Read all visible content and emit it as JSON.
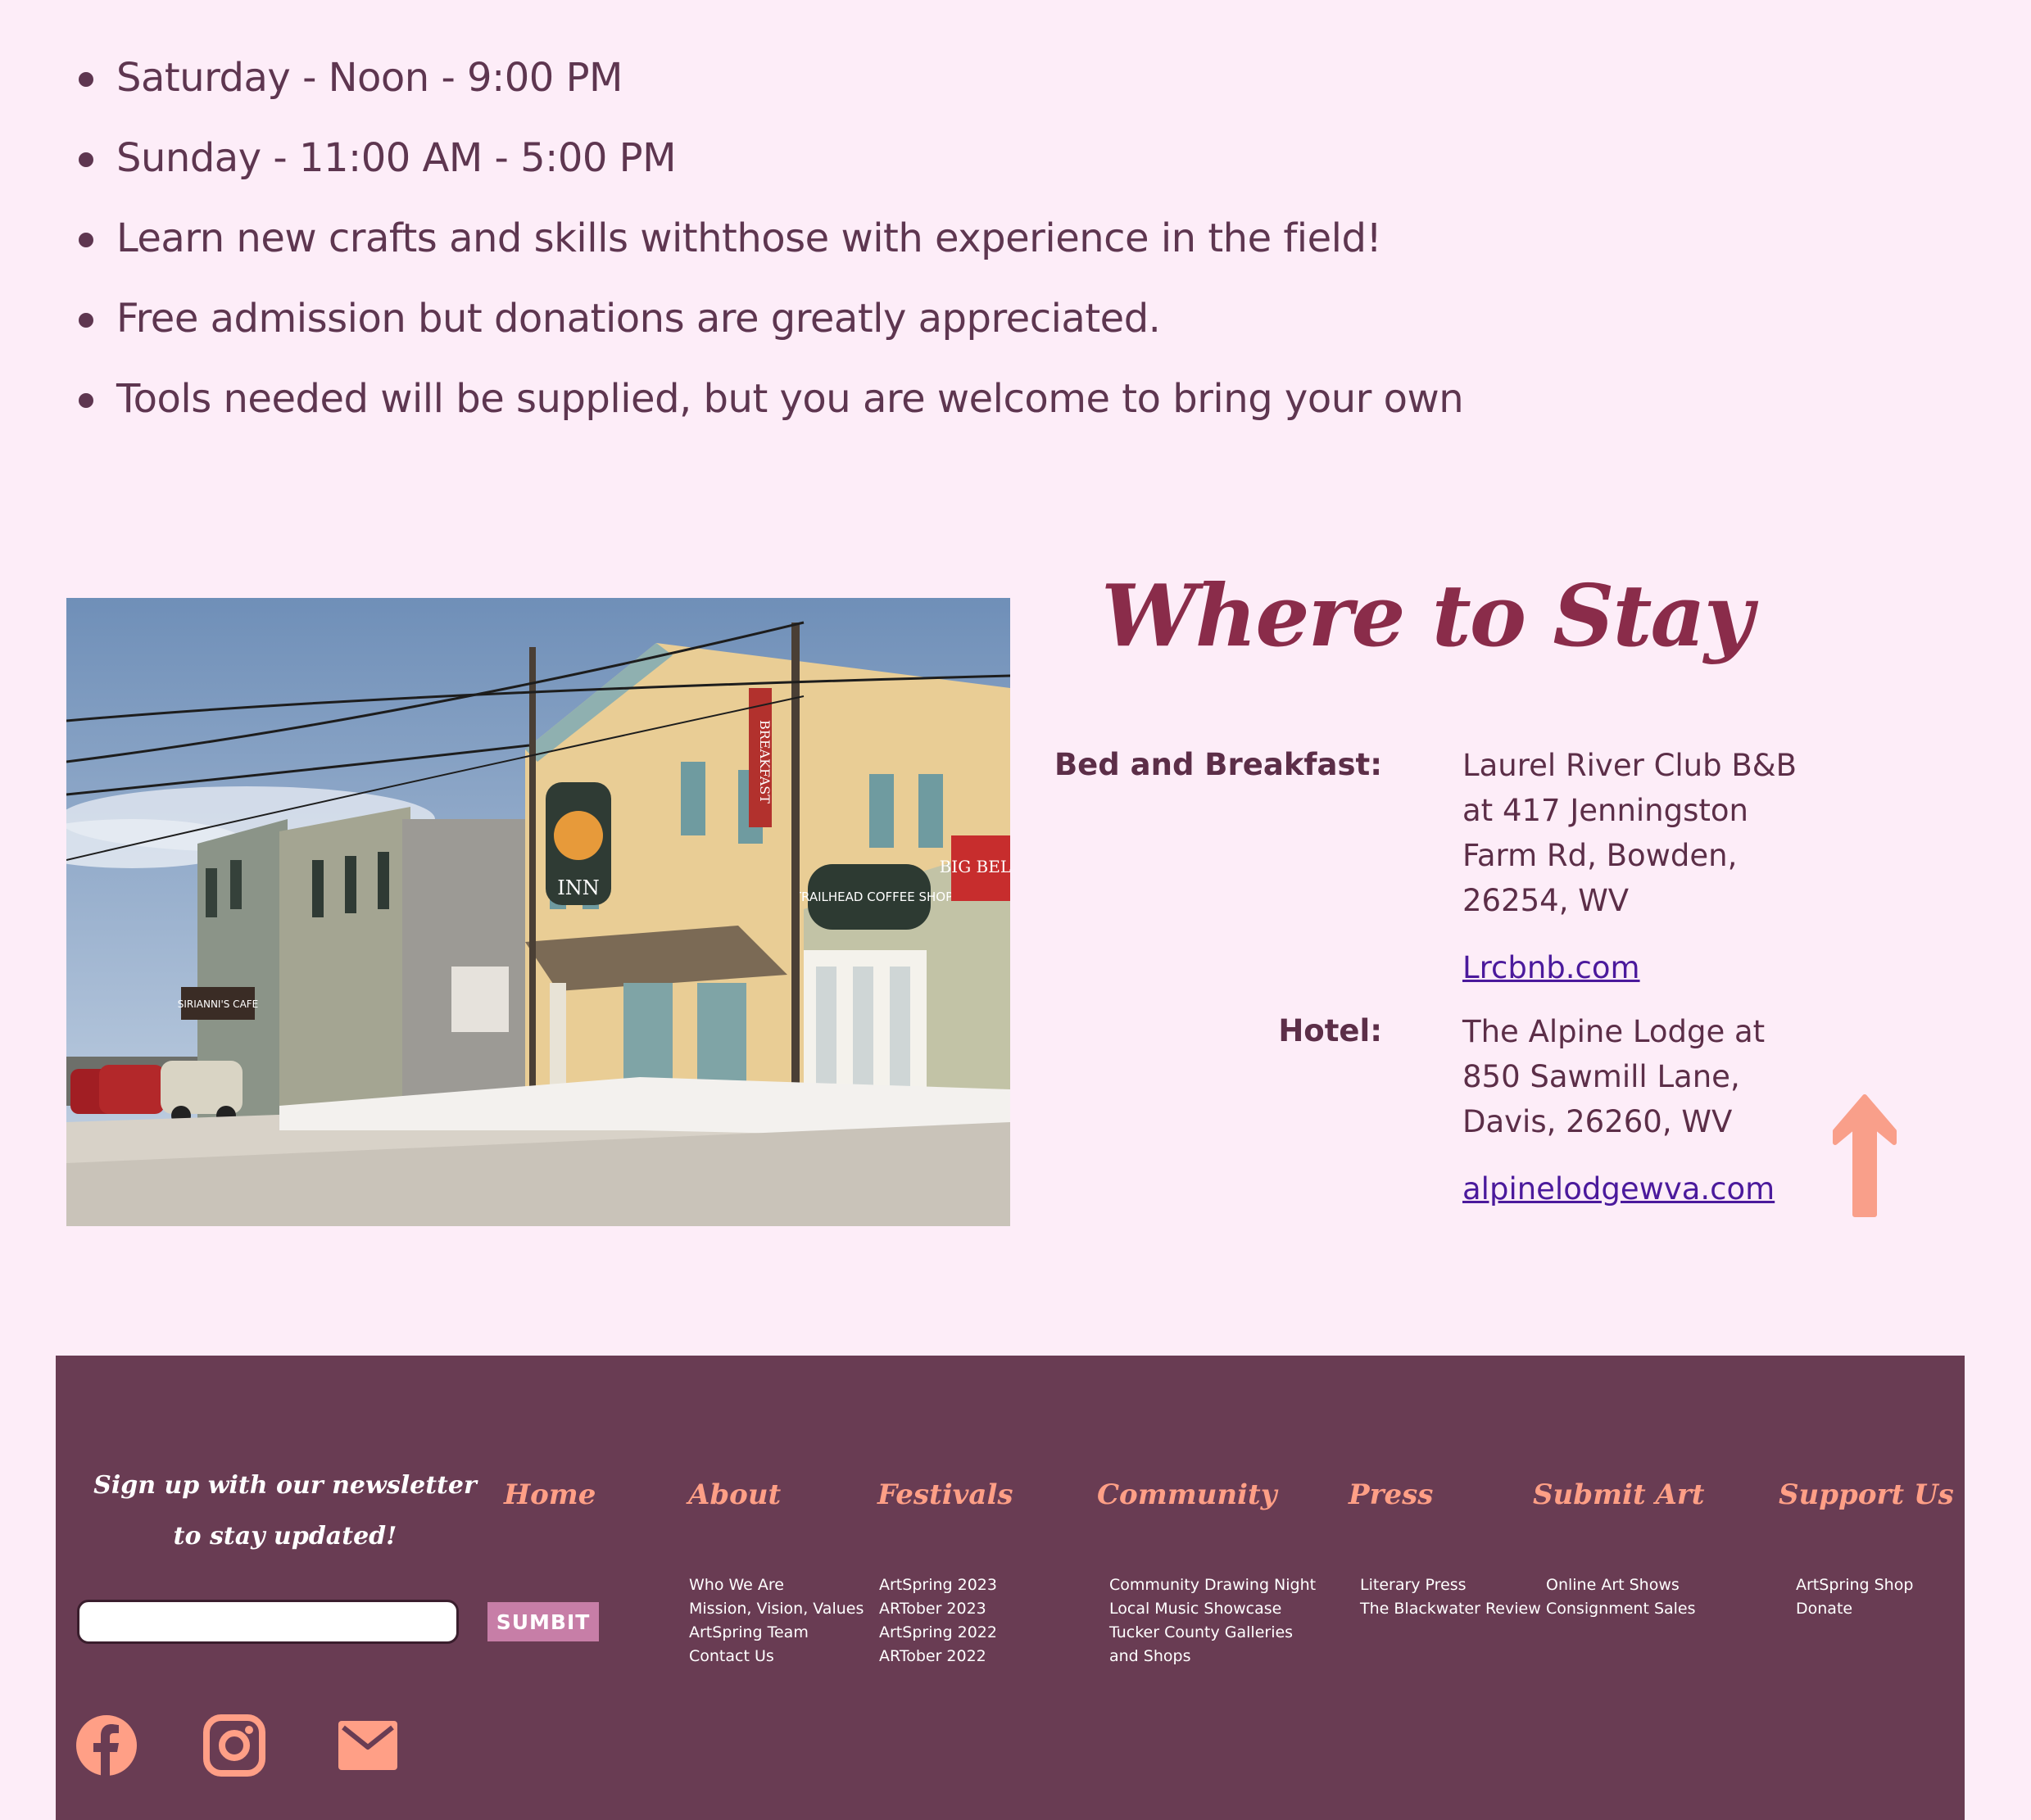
{
  "schedule": {
    "items": [
      "Saturday - Noon - 9:00 PM",
      "Sunday - 11:00 AM - 5:00 PM",
      "Learn new crafts and skills withthose with experience in the field!",
      "Free admission but donations are greatly appreciated.",
      "Tools needed will be supplied, but you are welcome to bring your own"
    ]
  },
  "stay": {
    "title": "Where to Stay",
    "bnb": {
      "label": "Bed and Breakfast:",
      "lines": [
        "Laurel River Club B&B",
        "at 417 Jenningston",
        "Farm Rd, Bowden,",
        "26254, WV"
      ],
      "link": "Lrcbnb.com"
    },
    "hotel": {
      "label": "Hotel:",
      "lines": [
        "The Alpine Lodge at",
        "850 Sawmill Lane,",
        "Davis, 26260, WV"
      ],
      "link": "alpinelodgewva.com"
    }
  },
  "photo": {
    "signs": [
      "BREAKFAST",
      "INN",
      "TRAILHEAD COFFEE SHOP",
      "BIG BELL",
      "SIRIANNI'S CAFE"
    ]
  },
  "footer": {
    "newsletter": {
      "line1": "Sign up with our newsletter",
      "line2": "to stay updated!",
      "submit_label": "SUMBIT"
    },
    "nav": {
      "home": {
        "title": "Home"
      },
      "about": {
        "title": "About",
        "links": [
          "Who We Are",
          "Mission, Vision, Values",
          "ArtSpring Team",
          "Contact Us"
        ]
      },
      "festivals": {
        "title": "Festivals",
        "links": [
          "ArtSpring 2023",
          "ARTober 2023",
          "ArtSpring 2022",
          "ARTober 2022"
        ]
      },
      "community": {
        "title": "Community",
        "links": [
          "Community Drawing Night",
          "Local Music Showcase",
          "Tucker County Galleries",
          "and Shops"
        ]
      },
      "press": {
        "title": "Press",
        "links": [
          "Literary Press",
          "The Blackwater Review"
        ]
      },
      "submit_art": {
        "title": "Submit Art",
        "links": [
          "Online Art Shows",
          "Consignment Sales"
        ]
      },
      "support": {
        "title": "Support Us",
        "links": [
          "ArtSpring Shop",
          "Donate"
        ]
      }
    },
    "social": [
      "facebook-icon",
      "instagram-icon",
      "mail-icon"
    ]
  },
  "colors": {
    "page_bg": "#fdedf8",
    "heading": "#8a2c4a",
    "footer_bg": "#693c53",
    "accent": "#ff9f86",
    "link": "#4b1a9c"
  }
}
